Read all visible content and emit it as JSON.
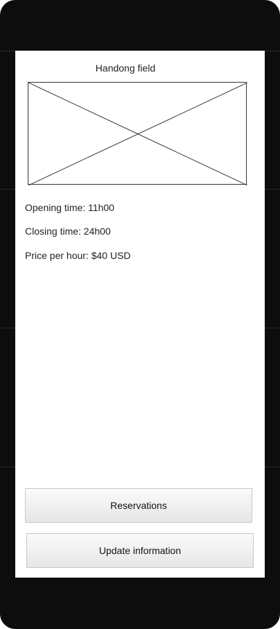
{
  "screen": {
    "title": "Handong field",
    "image_placeholder": "image-placeholder",
    "details": {
      "opening_time": "Opening time: 11h00",
      "closing_time": "Closing time: 24h00",
      "price": "Price per hour: $40 USD"
    },
    "buttons": {
      "reservations": "Reservations",
      "update_information": "Update information"
    }
  },
  "colors": {
    "frame": "#0d0d0d",
    "screen": "#ffffff",
    "button_border": "#c6c6c6"
  }
}
